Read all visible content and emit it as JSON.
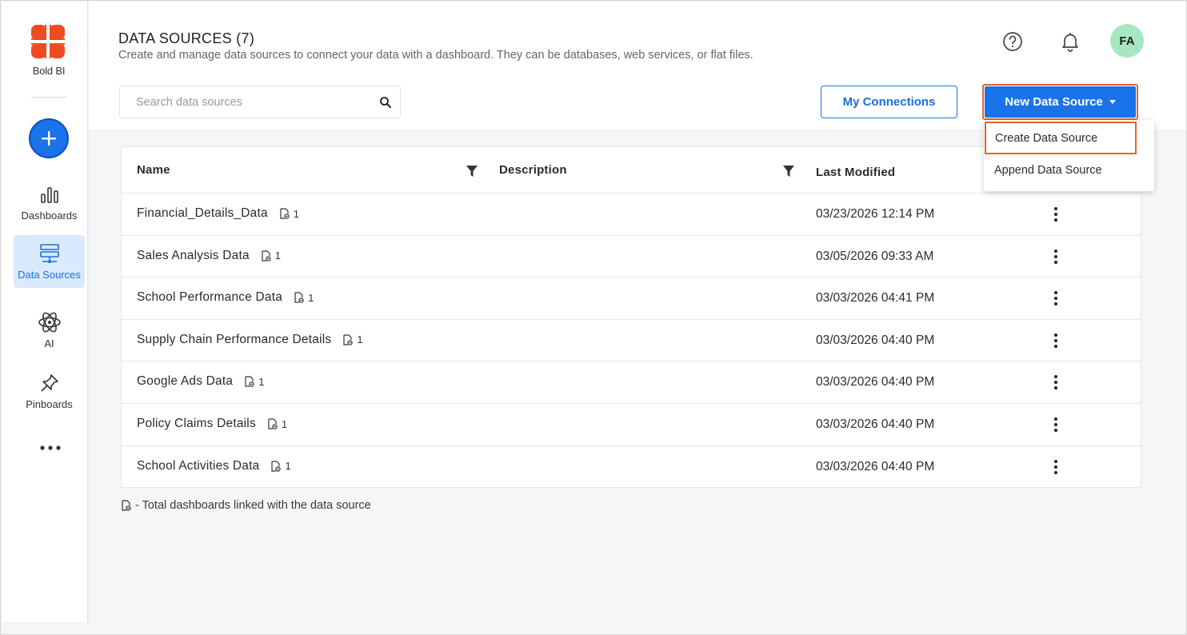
{
  "app": {
    "logo_text": "Bold BI",
    "accent_color": "#1a73e8",
    "highlight_color": "#e8622a"
  },
  "sidebar": {
    "items": [
      {
        "label": "Dashboards",
        "icon": "bar-chart-icon"
      },
      {
        "label": "Data Sources",
        "icon": "server-icon",
        "active": true
      },
      {
        "label": "AI",
        "icon": "atom-icon"
      },
      {
        "label": "Pinboards",
        "icon": "pin-icon"
      }
    ]
  },
  "header": {
    "title": "DATA SOURCES (7)",
    "subtitle": "Create and manage data sources to connect your data with a dashboard. They can be databases, web services, or flat files.",
    "avatar_initials": "FA"
  },
  "toolbar": {
    "search_placeholder": "Search data sources",
    "my_connections": "My Connections",
    "new_data_source": "New Data Source"
  },
  "dropdown": {
    "items": [
      "Create Data Source",
      "Append Data Source"
    ]
  },
  "table": {
    "columns": [
      "Name",
      "Description",
      "Last Modified"
    ],
    "rows": [
      {
        "name": "Financial_Details_Data",
        "links": "1",
        "modified": "03/23/2026 12:14 PM"
      },
      {
        "name": "Sales Analysis Data",
        "links": "1",
        "modified": "03/05/2026 09:33 AM"
      },
      {
        "name": "School Performance Data",
        "links": "1",
        "modified": "03/03/2026 04:41 PM"
      },
      {
        "name": "Supply Chain Performance Details",
        "links": "1",
        "modified": "03/03/2026 04:40 PM"
      },
      {
        "name": "Google Ads Data",
        "links": "1",
        "modified": "03/03/2026 04:40 PM"
      },
      {
        "name": "Policy Claims Details",
        "links": "1",
        "modified": "03/03/2026 04:40 PM"
      },
      {
        "name": "School Activities Data",
        "links": "1",
        "modified": "03/03/2026 04:40 PM"
      }
    ]
  },
  "legend": {
    "text": "- Total dashboards linked with the data source"
  }
}
